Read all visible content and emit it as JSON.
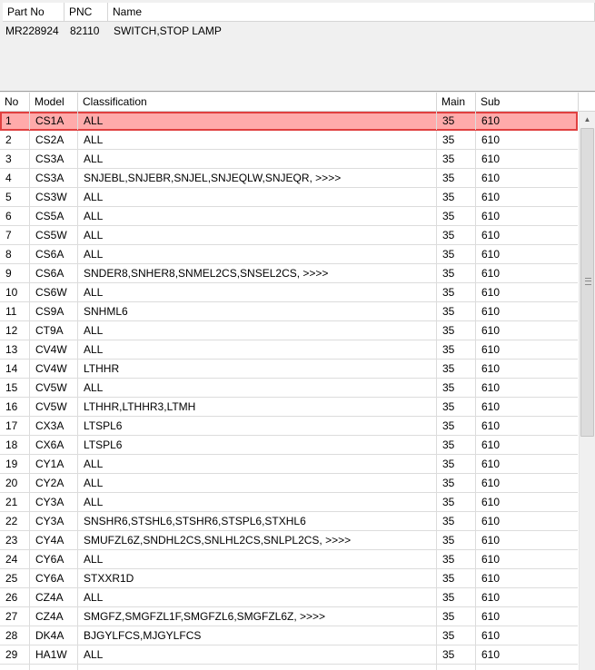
{
  "part_panel": {
    "headers": {
      "part_no": "Part No",
      "pnc": "PNC",
      "name": "Name"
    },
    "row": {
      "part_no": "MR228924",
      "pnc": "82110",
      "name": "SWITCH,STOP LAMP"
    }
  },
  "model_list": {
    "headers": {
      "no": "No",
      "model": "Model",
      "classification": "Classification",
      "main": "Main",
      "sub": "Sub"
    },
    "selected_index": 0,
    "highlight_color": "#ffaaaa",
    "rows": [
      {
        "no": "1",
        "model": "CS1A",
        "classification": "ALL",
        "main": "35",
        "sub": "610"
      },
      {
        "no": "2",
        "model": "CS2A",
        "classification": "ALL",
        "main": "35",
        "sub": "610"
      },
      {
        "no": "3",
        "model": "CS3A",
        "classification": "ALL",
        "main": "35",
        "sub": "610"
      },
      {
        "no": "4",
        "model": "CS3A",
        "classification": "SNJEBL,SNJEBR,SNJEL,SNJEQLW,SNJEQR,  >>>>",
        "main": "35",
        "sub": "610"
      },
      {
        "no": "5",
        "model": "CS3W",
        "classification": "ALL",
        "main": "35",
        "sub": "610"
      },
      {
        "no": "6",
        "model": "CS5A",
        "classification": "ALL",
        "main": "35",
        "sub": "610"
      },
      {
        "no": "7",
        "model": "CS5W",
        "classification": "ALL",
        "main": "35",
        "sub": "610"
      },
      {
        "no": "8",
        "model": "CS6A",
        "classification": "ALL",
        "main": "35",
        "sub": "610"
      },
      {
        "no": "9",
        "model": "CS6A",
        "classification": "SNDER8,SNHER8,SNMEL2CS,SNSEL2CS,  >>>>",
        "main": "35",
        "sub": "610"
      },
      {
        "no": "10",
        "model": "CS6W",
        "classification": "ALL",
        "main": "35",
        "sub": "610"
      },
      {
        "no": "11",
        "model": "CS9A",
        "classification": "SNHML6",
        "main": "35",
        "sub": "610"
      },
      {
        "no": "12",
        "model": "CT9A",
        "classification": "ALL",
        "main": "35",
        "sub": "610"
      },
      {
        "no": "13",
        "model": "CV4W",
        "classification": "ALL",
        "main": "35",
        "sub": "610"
      },
      {
        "no": "14",
        "model": "CV4W",
        "classification": "LTHHR",
        "main": "35",
        "sub": "610"
      },
      {
        "no": "15",
        "model": "CV5W",
        "classification": "ALL",
        "main": "35",
        "sub": "610"
      },
      {
        "no": "16",
        "model": "CV5W",
        "classification": "LTHHR,LTHHR3,LTMH",
        "main": "35",
        "sub": "610"
      },
      {
        "no": "17",
        "model": "CX3A",
        "classification": "LTSPL6",
        "main": "35",
        "sub": "610"
      },
      {
        "no": "18",
        "model": "CX6A",
        "classification": "LTSPL6",
        "main": "35",
        "sub": "610"
      },
      {
        "no": "19",
        "model": "CY1A",
        "classification": "ALL",
        "main": "35",
        "sub": "610"
      },
      {
        "no": "20",
        "model": "CY2A",
        "classification": "ALL",
        "main": "35",
        "sub": "610"
      },
      {
        "no": "21",
        "model": "CY3A",
        "classification": "ALL",
        "main": "35",
        "sub": "610"
      },
      {
        "no": "22",
        "model": "CY3A",
        "classification": "SNSHR6,STSHL6,STSHR6,STSPL6,STXHL6",
        "main": "35",
        "sub": "610"
      },
      {
        "no": "23",
        "model": "CY4A",
        "classification": "SMUFZL6Z,SNDHL2CS,SNLHL2CS,SNLPL2CS,  >>>>",
        "main": "35",
        "sub": "610"
      },
      {
        "no": "24",
        "model": "CY6A",
        "classification": "ALL",
        "main": "35",
        "sub": "610"
      },
      {
        "no": "25",
        "model": "CY6A",
        "classification": "STXXR1D",
        "main": "35",
        "sub": "610"
      },
      {
        "no": "26",
        "model": "CZ4A",
        "classification": "ALL",
        "main": "35",
        "sub": "610"
      },
      {
        "no": "27",
        "model": "CZ4A",
        "classification": "SMGFZ,SMGFZL1F,SMGFZL6,SMGFZL6Z,  >>>>",
        "main": "35",
        "sub": "610"
      },
      {
        "no": "28",
        "model": "DK4A",
        "classification": "BJGYLFCS,MJGYLFCS",
        "main": "35",
        "sub": "610"
      },
      {
        "no": "29",
        "model": "HA1W",
        "classification": "ALL",
        "main": "35",
        "sub": "610"
      },
      {
        "no": "",
        "model": "",
        "classification": "",
        "main": "",
        "sub": ""
      }
    ]
  },
  "scrollbar": {
    "up_arrow_icon": "triangle-up-icon",
    "grip_icon": "grip-lines-icon"
  }
}
